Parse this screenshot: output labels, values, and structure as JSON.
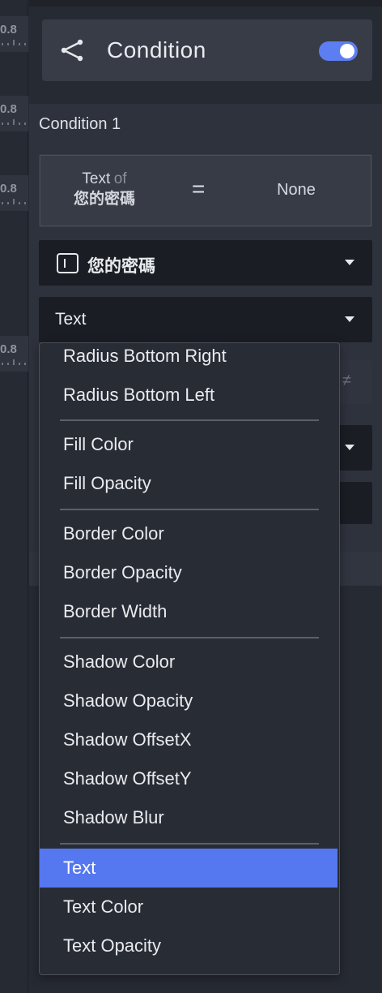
{
  "left_column": {
    "values": [
      "0.8",
      "0.8",
      "0.8",
      "0.8"
    ]
  },
  "header": {
    "icon": "share-icon",
    "title": "Condition",
    "toggle_on": true,
    "toggle_color": "#5c7ef0"
  },
  "condition": {
    "label": "Condition 1",
    "subject_prop": "Text",
    "subject_of": "of",
    "subject_field": "您的密碼",
    "operator": "=",
    "value": "None"
  },
  "field_select": {
    "icon": "text-field-icon",
    "label": "您的密碼"
  },
  "property_select": {
    "label": "Text"
  },
  "behind_menu": {
    "operator_glyph": "≠"
  },
  "menu": {
    "accent": "#5577f0",
    "groups": [
      [
        "Radius Bottom Right",
        "Radius Bottom Left"
      ],
      [
        "Fill Color",
        "Fill Opacity"
      ],
      [
        "Border Color",
        "Border Opacity",
        "Border Width"
      ],
      [
        "Shadow Color",
        "Shadow Opacity",
        "Shadow OffsetX",
        "Shadow OffsetY",
        "Shadow Blur"
      ],
      [
        "Text",
        "Text Color",
        "Text Opacity"
      ]
    ],
    "selected": "Text"
  }
}
